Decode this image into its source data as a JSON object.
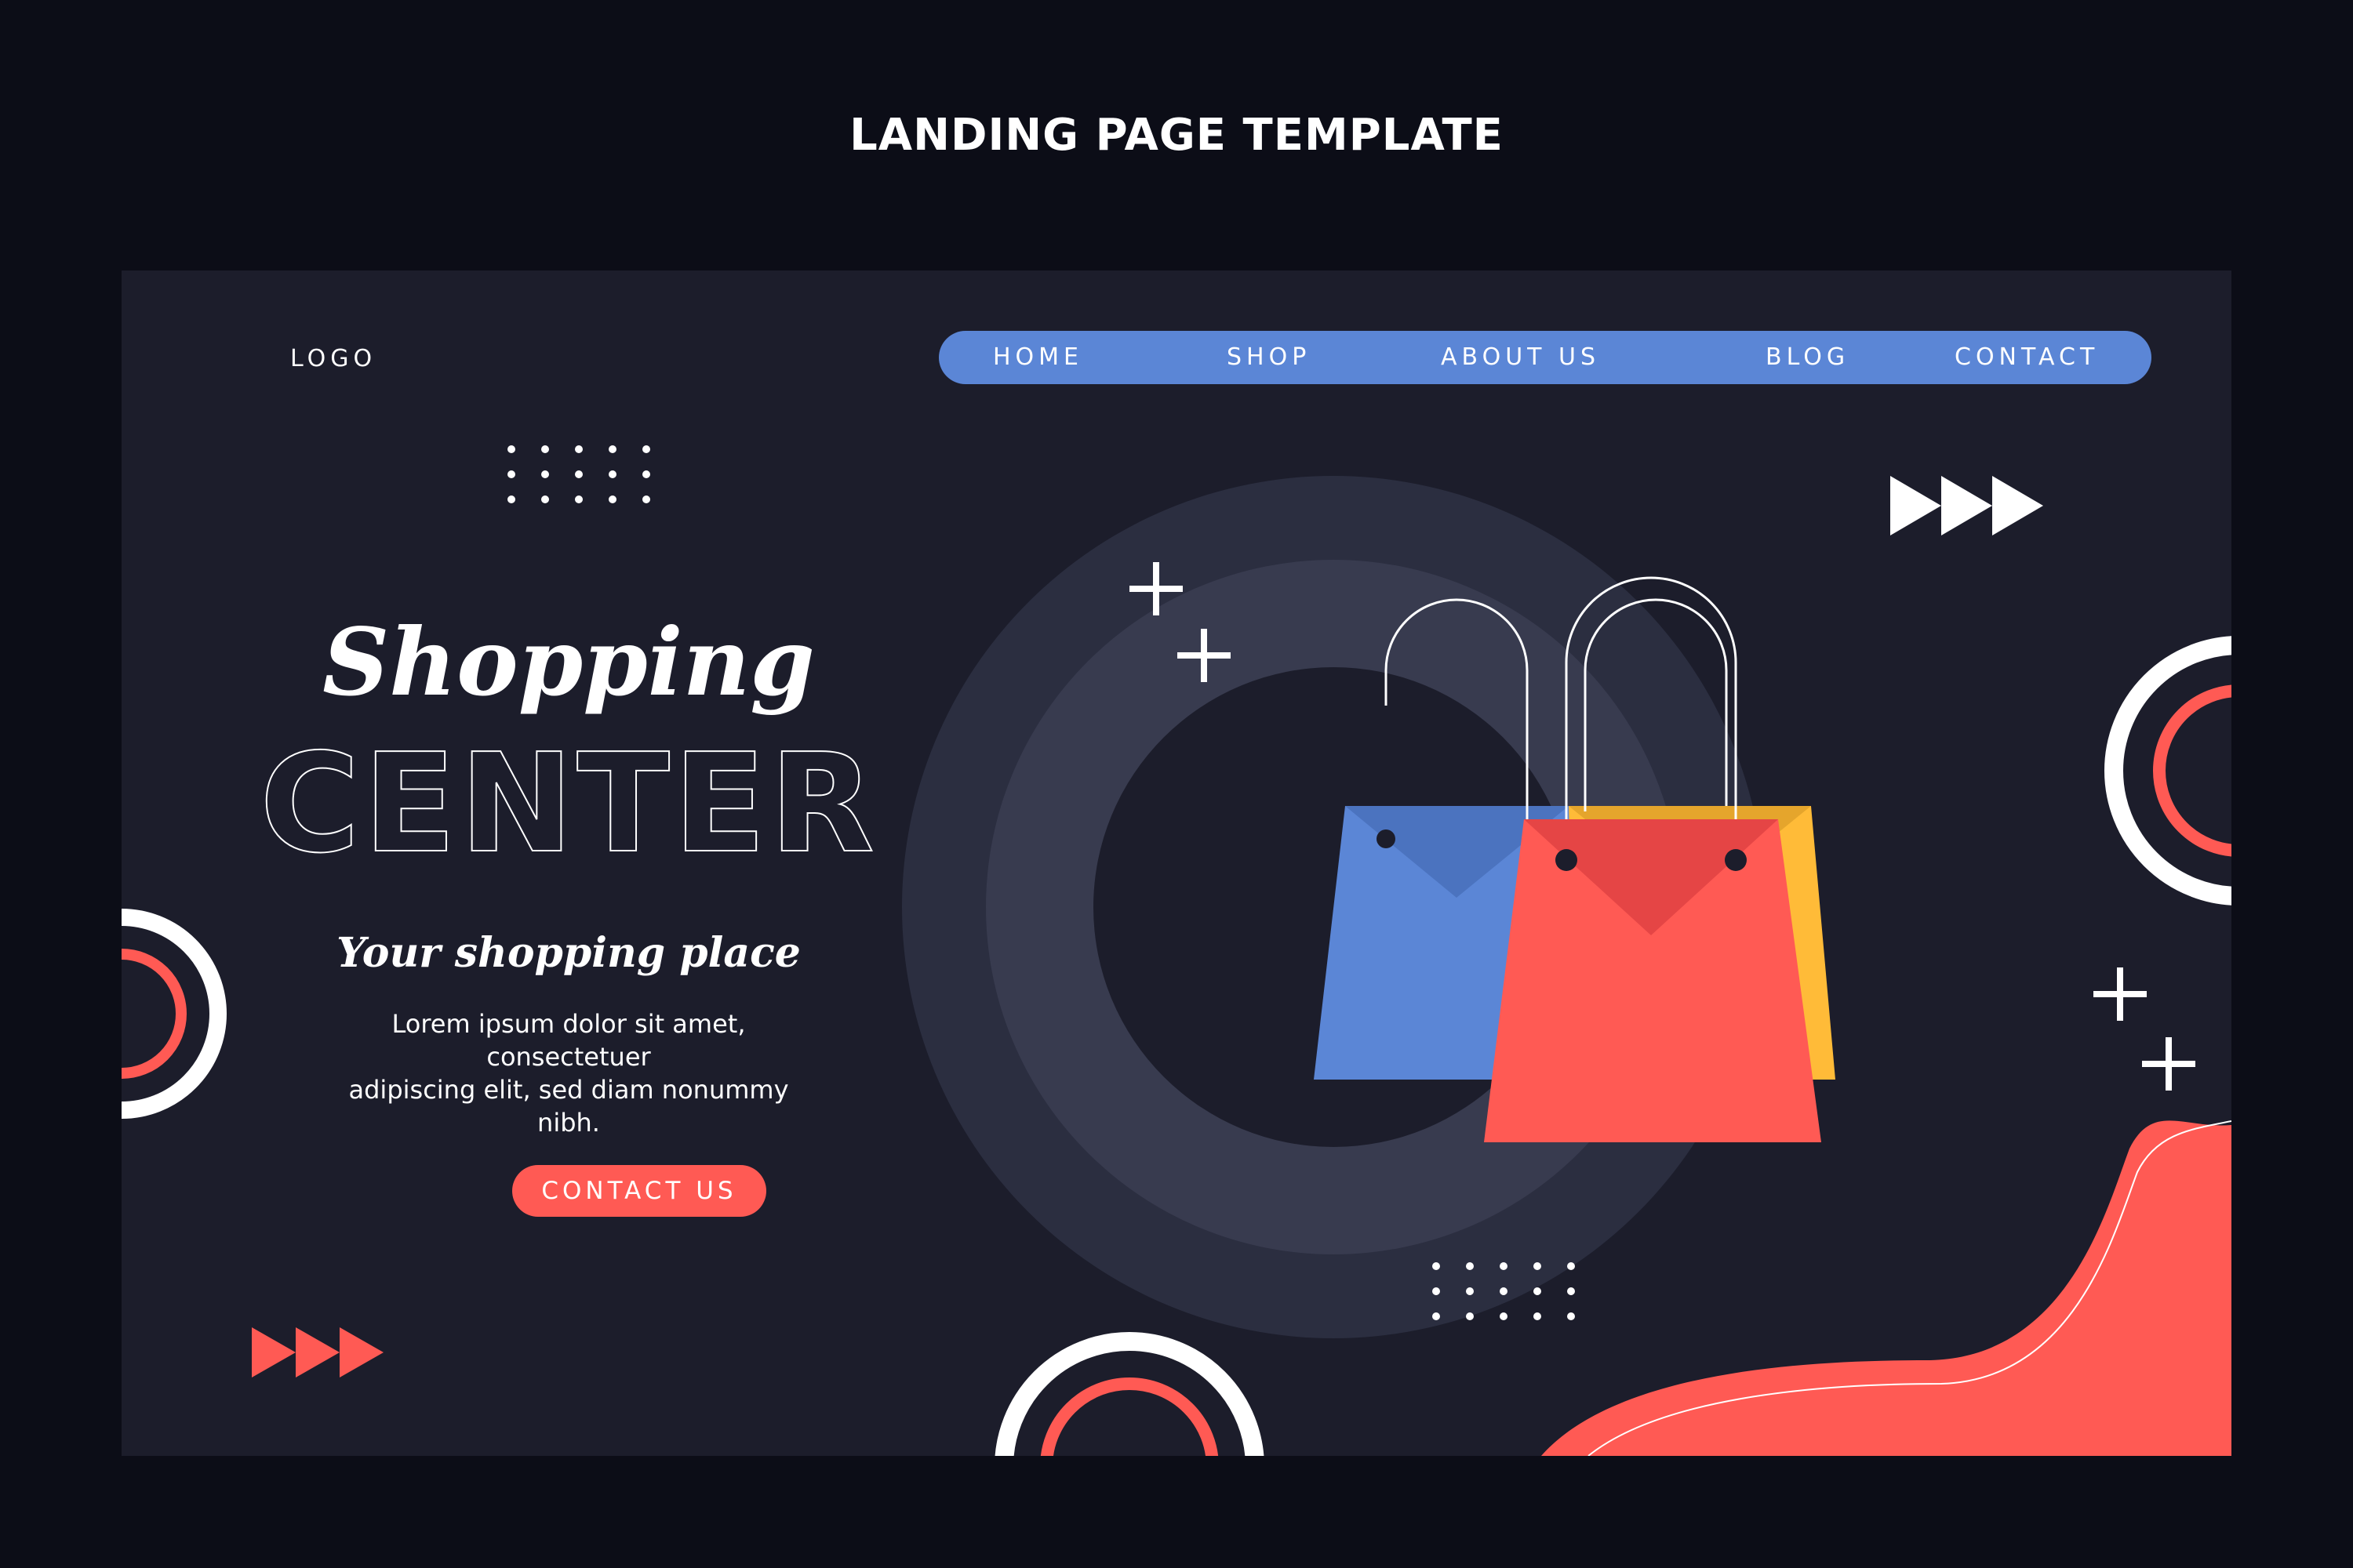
{
  "page_title": "LANDING PAGE TEMPLATE",
  "header": {
    "logo": "LOGO",
    "nav": [
      "HOME",
      "SHOP",
      "ABOUT US",
      "BLOG",
      "CONTACT"
    ]
  },
  "hero": {
    "title_script": "Shopping",
    "title_outline": "CENTER",
    "subtitle": "Your shopping place",
    "body_line1": "Lorem ipsum dolor sit amet, consectetuer",
    "body_line2": "adipiscing elit, sed diam nonummy nibh.",
    "cta_label": "CONTACT US"
  },
  "colors": {
    "background": "#0c0d17",
    "panel": "#1c1d2b",
    "nav": "#5b86d6",
    "accent_red": "#ff5a54",
    "accent_yellow": "#ffbb38",
    "accent_blue": "#5b86d6",
    "circle_outer": "#2b2e40",
    "circle_mid": "#383b4f"
  },
  "icons": {
    "arrows": "triple-triangle-arrows",
    "plus": "plus-sign",
    "dots": "dot-grid",
    "bags": "shopping-bags"
  }
}
